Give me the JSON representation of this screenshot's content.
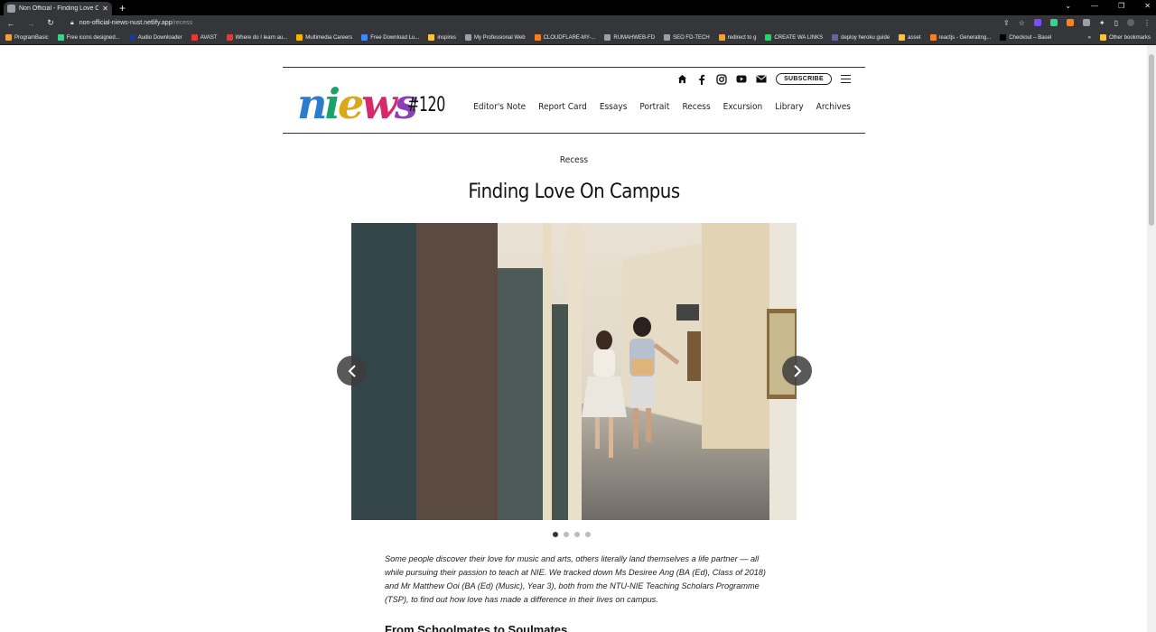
{
  "browser": {
    "tab_title": "Non Official - Finding Love On C",
    "new_tab_symbol": "+",
    "url_host": "non-official-niews-nust.netlify.app",
    "url_path": "/recess",
    "window_controls": [
      "⌄",
      "—",
      "❐",
      "✕"
    ],
    "bookmarks": [
      {
        "label": "ProgramBasic",
        "color": "#e8a33d"
      },
      {
        "label": "Free icons designed...",
        "color": "#3ecf8e"
      },
      {
        "label": "Audio Downloader",
        "color": "#1e3a8a"
      },
      {
        "label": "AVAST",
        "color": "#e53935"
      },
      {
        "label": "Where do I learn au...",
        "color": "#e53935"
      },
      {
        "label": "Multimedia Careers",
        "color": "#f5b400"
      },
      {
        "label": "Free Download Lu...",
        "color": "#4285f4"
      },
      {
        "label": "inspires",
        "color": "#f5c542"
      },
      {
        "label": "My Professional Web",
        "color": "#9aa0a6"
      },
      {
        "label": "CLOUDFLARE-MY-...",
        "color": "#f38020"
      },
      {
        "label": "RUMAHWEB-FD",
        "color": "#9aa0a6"
      },
      {
        "label": "SEO FD-TECH",
        "color": "#9aa0a6"
      },
      {
        "label": "redirect to g",
        "color": "#e8a33d"
      },
      {
        "label": "CREATE WA LINKS",
        "color": "#25d366"
      },
      {
        "label": "deploy heroku guide",
        "color": "#6762a6"
      },
      {
        "label": "asset",
        "color": "#f5c542"
      },
      {
        "label": "reactjs - Generating...",
        "color": "#f48024"
      },
      {
        "label": "Checkout – Basel",
        "color": "#000000"
      }
    ],
    "bookmarks_more": "»",
    "other_bookmarks": "Other bookmarks"
  },
  "site": {
    "logo": {
      "l1": "n",
      "l2": "i",
      "l3": "e",
      "l4": "w",
      "l5": "s"
    },
    "issue": "#120",
    "subscribe_label": "SUBSCRIBE",
    "nav": [
      "Editor's Note",
      "Report Card",
      "Essays",
      "Portrait",
      "Recess",
      "Excursion",
      "Library",
      "Archives"
    ]
  },
  "article": {
    "category": "Recess",
    "title": "Finding Love On Campus",
    "carousel": {
      "total_slides": 4,
      "active_index": 0
    },
    "intro": "Some people discover their love for music and arts, others literally land themselves a life partner — all while pursuing their passion to teach at NIE. We tracked down Ms Desiree Ang (BA (Ed), Class of 2018) and Mr Matthew Ooi (BA (Ed) (Music), Year 3), both from the NTU-NIE Teaching Scholars Programme (TSP), to find out how love has made a difference in their lives on campus.",
    "section_heading": "From Schoolmates to Soulmates"
  }
}
